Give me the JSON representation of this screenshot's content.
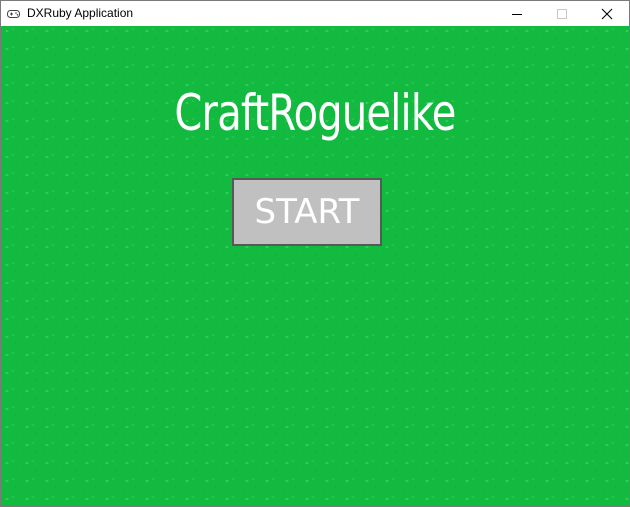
{
  "window": {
    "title": "DXRuby Application",
    "icon": "gamepad-icon",
    "controls": {
      "minimize_icon": "minimize-icon",
      "maximize_icon": "maximize-icon",
      "close_icon": "close-icon"
    }
  },
  "game": {
    "title": "CraftRoguelike",
    "start_label": "START"
  },
  "colors": {
    "background": "#12bb40",
    "title_text": "#ffffff",
    "button_fill": "#c0c0c0",
    "button_border": "#585858",
    "button_text": "#ffffff"
  }
}
